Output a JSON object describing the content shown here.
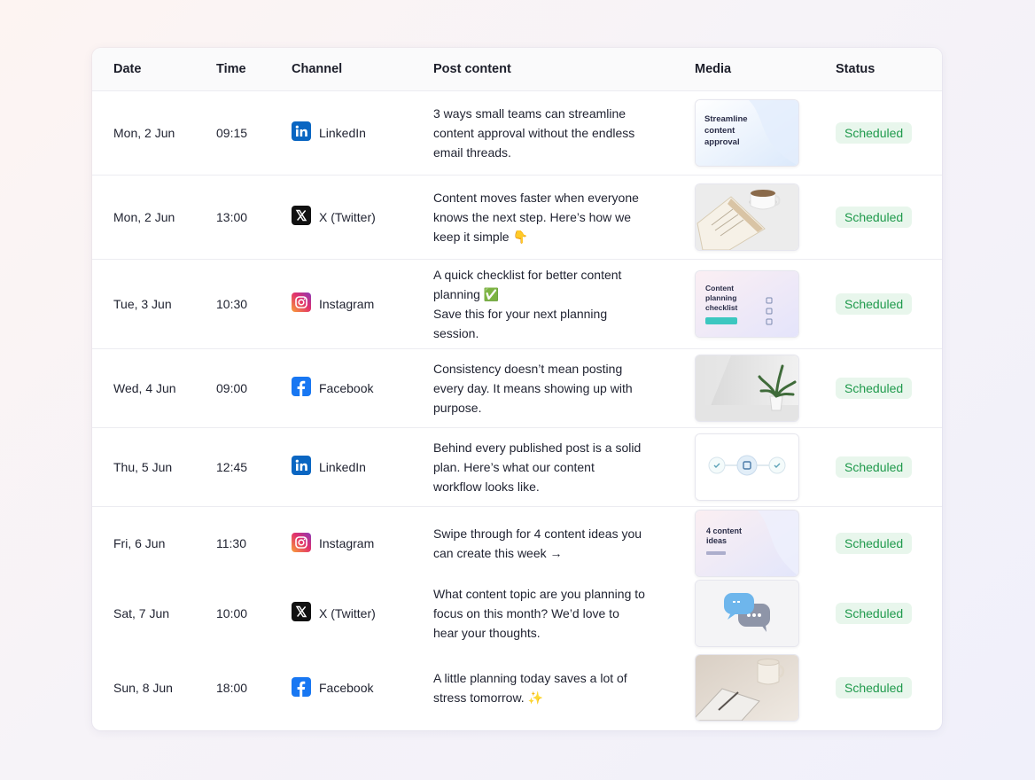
{
  "table": {
    "columns": [
      "Date",
      "Time",
      "Channel",
      "Post content",
      "Media",
      "Status"
    ],
    "rows": [
      {
        "date": "Mon, 2 Jun",
        "time": "09:15",
        "channel": "LinkedIn",
        "channel_icon": "linkedin-icon",
        "post": "3 ways small teams can streamline content approval without the endless email threads.",
        "media": "thumbnail-streamline-card",
        "media_text": [
          "Streamline",
          "content",
          "approval"
        ],
        "status": "Scheduled"
      },
      {
        "date": "Mon, 2 Jun",
        "time": "13:00",
        "channel": "X (Twitter)",
        "channel_icon": "x-twitter-icon",
        "post": "Content moves faster when everyone knows the next step. Here’s how we keep it simple 👇",
        "media": "thumbnail-coffee-notebook",
        "media_text": [],
        "status": "Scheduled"
      },
      {
        "date": "Tue, 3 Jun",
        "time": "10:30",
        "channel": "Instagram",
        "channel_icon": "instagram-icon",
        "post": "A quick checklist for better content planning ✅\nSave this for your next planning session.",
        "media": "thumbnail-checklist-card",
        "media_text": [
          "Content",
          "planning",
          "checklist"
        ],
        "status": "Scheduled"
      },
      {
        "date": "Wed, 4 Jun",
        "time": "09:00",
        "channel": "Facebook",
        "channel_icon": "facebook-icon",
        "post": "Consistency doesn’t mean posting every day. It means showing up with purpose.",
        "media": "thumbnail-plant",
        "media_text": [],
        "status": "Scheduled"
      },
      {
        "date": "Thu, 5 Jun",
        "time": "12:45",
        "channel": "LinkedIn",
        "channel_icon": "linkedin-icon",
        "post": "Behind every published post is a solid plan. Here’s what our content workflow looks like.",
        "media": "thumbnail-workflow",
        "media_text": [],
        "status": "Scheduled"
      },
      {
        "date": "Fri, 6 Jun",
        "time": "11:30",
        "channel": "Instagram",
        "channel_icon": "instagram-icon",
        "post": "Swipe through for 4 content ideas you can create this week →",
        "media": "thumbnail-content-ideas",
        "media_text": [
          "4 content",
          "ideas"
        ],
        "status": "Scheduled"
      },
      {
        "date": "Sat, 7 Jun",
        "time": "10:00",
        "channel": "X (Twitter)",
        "channel_icon": "x-twitter-icon",
        "post": "What content topic are you planning to focus on this month? We’d love to hear your thoughts.",
        "media": "thumbnail-chat-bubbles",
        "media_text": [],
        "status": "Scheduled"
      },
      {
        "date": "Sun, 8 Jun",
        "time": "18:00",
        "channel": "Facebook",
        "channel_icon": "facebook-icon",
        "post": "A little planning today saves a lot of stress tomorrow. ✨",
        "media": "thumbnail-mug-notebook",
        "media_text": [],
        "status": "Scheduled"
      }
    ]
  },
  "colors": {
    "linkedin": "#0a66c2",
    "x": "#111111",
    "facebook": "#1877f2",
    "instagram_start": "#f9a13a",
    "instagram_mid": "#e1306c",
    "instagram_end": "#8a3ab9",
    "status_bg": "#e8f6ec",
    "status_text": "#1f9a4c"
  }
}
